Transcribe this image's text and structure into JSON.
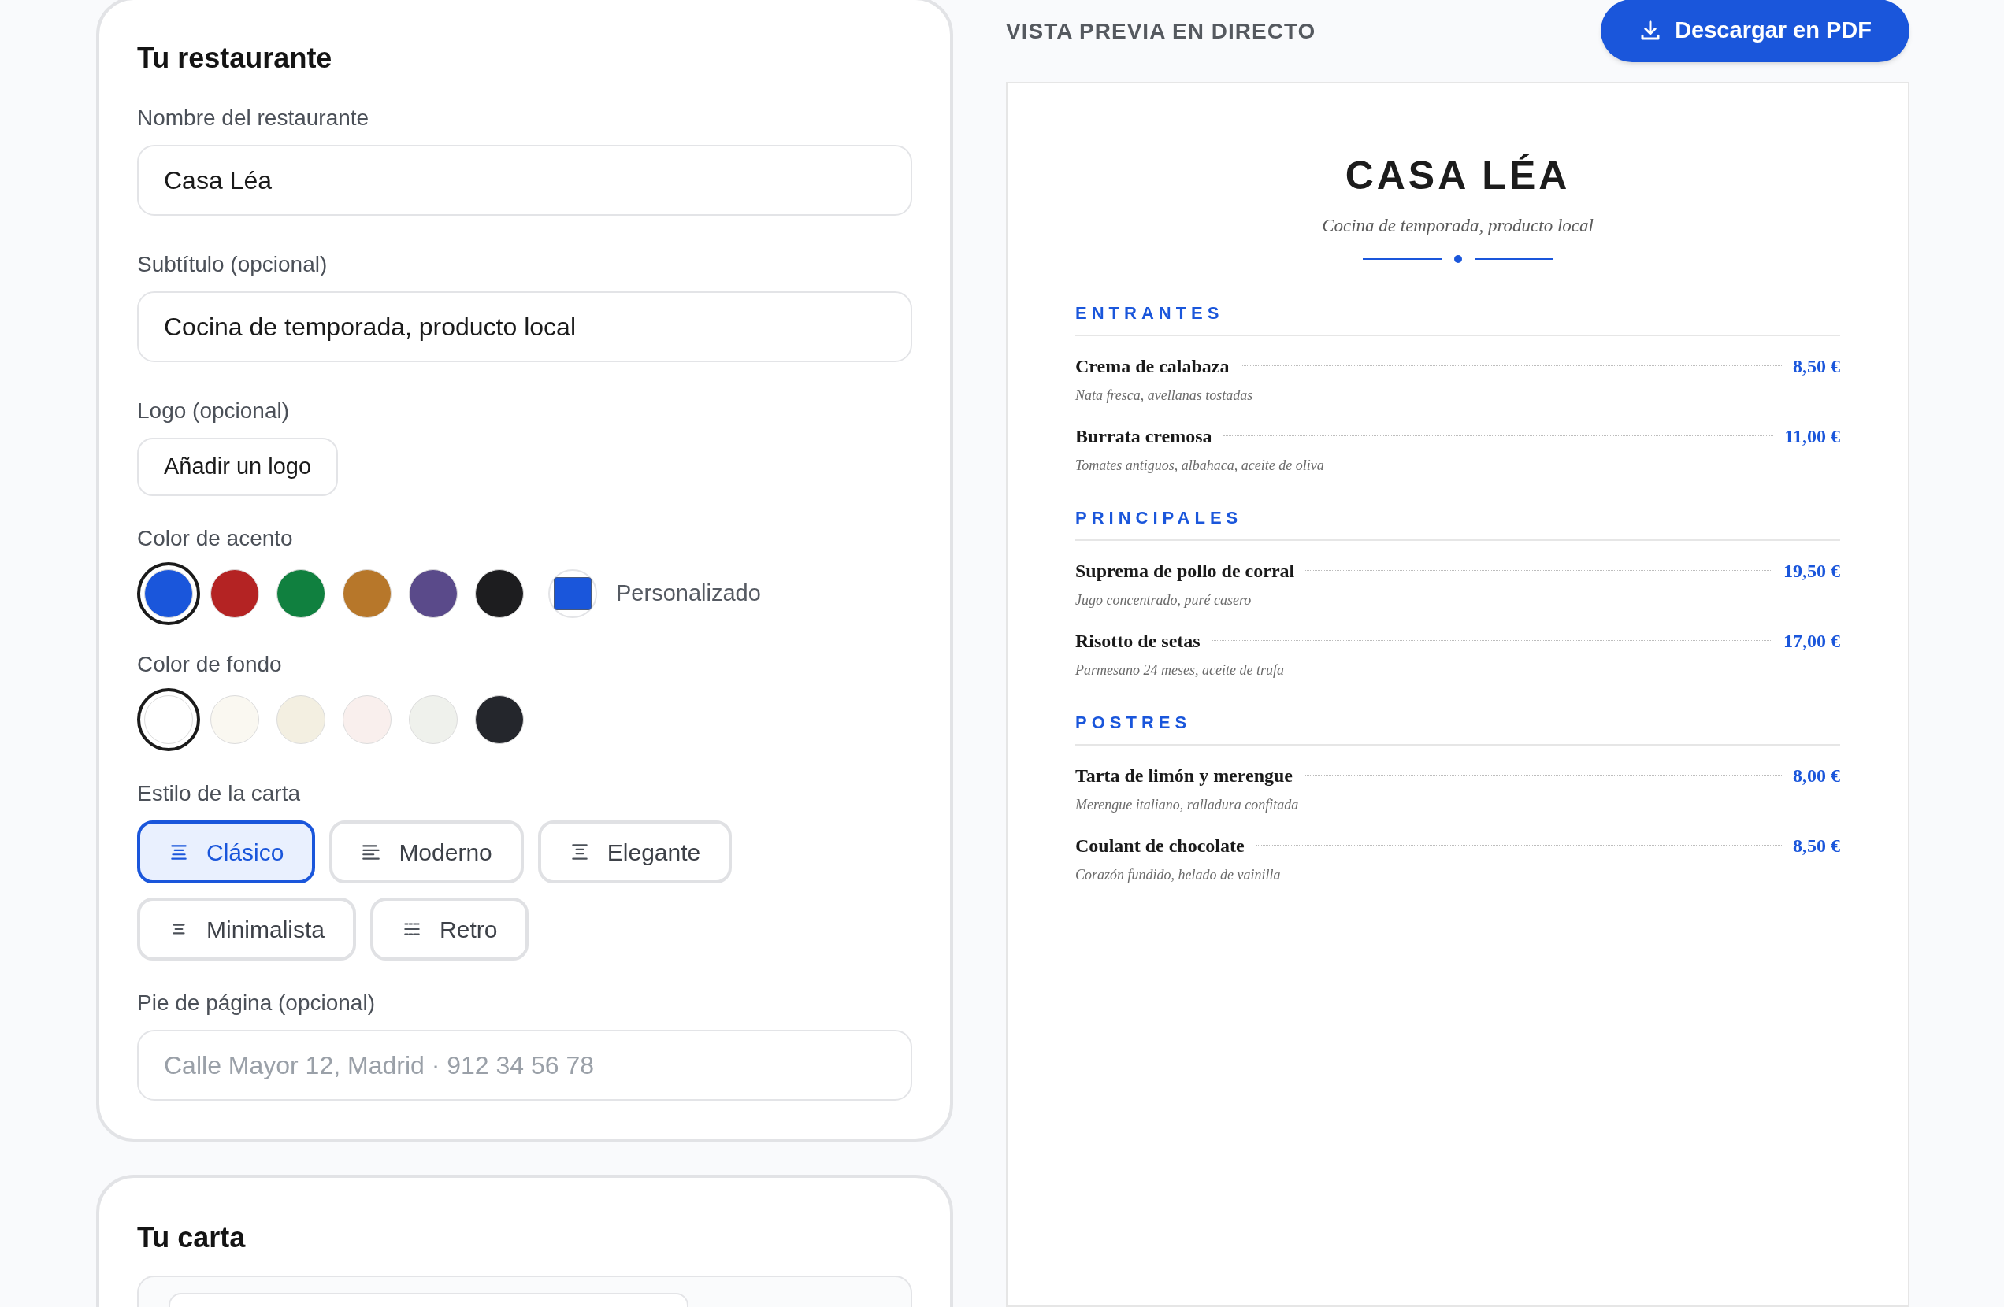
{
  "settings": {
    "title": "Tu restaurante",
    "name_field": {
      "label": "Nombre del restaurante",
      "value": "Casa Léa"
    },
    "subtitle_field": {
      "label": "Subtítulo (opcional)",
      "value": "Cocina de temporada, producto local"
    },
    "logo": {
      "label": "Logo (opcional)",
      "button": "Añadir un logo"
    },
    "accent": {
      "label": "Color de acento",
      "swatches": [
        {
          "color": "#1a56db",
          "selected": true
        },
        {
          "color": "#b42323",
          "selected": false
        },
        {
          "color": "#10803f",
          "selected": false
        },
        {
          "color": "#b7772a",
          "selected": false
        },
        {
          "color": "#5a4a8a",
          "selected": false
        },
        {
          "color": "#1d1d1f",
          "selected": false
        }
      ],
      "custom": {
        "color": "#1a56db",
        "label": "Personalizado"
      }
    },
    "background": {
      "label": "Color de fondo",
      "swatches": [
        {
          "color": "#ffffff",
          "selected": true
        },
        {
          "color": "#faf8f1",
          "selected": false
        },
        {
          "color": "#f3efe1",
          "selected": false
        },
        {
          "color": "#f9efed",
          "selected": false
        },
        {
          "color": "#eff1ec",
          "selected": false
        },
        {
          "color": "#24262c",
          "selected": false
        }
      ]
    },
    "style": {
      "label": "Estilo de la carta",
      "options": [
        {
          "label": "Clásico",
          "kind": "center",
          "selected": true
        },
        {
          "label": "Moderno",
          "kind": "left",
          "selected": false
        },
        {
          "label": "Elegante",
          "kind": "framed",
          "selected": false
        },
        {
          "label": "Minimalista",
          "kind": "short",
          "selected": false
        },
        {
          "label": "Retro",
          "kind": "dashed",
          "selected": false
        }
      ]
    },
    "footer_field": {
      "label": "Pie de página (opcional)",
      "placeholder": "Calle Mayor 12, Madrid · 912 34 56 78"
    }
  },
  "menu_card": {
    "title": "Tu carta"
  },
  "preview": {
    "heading": "VISTA PREVIA EN DIRECTO",
    "download_button": "Descargar en PDF",
    "title": "CASA LÉA",
    "subtitle": "Cocina de temporada, producto local",
    "sections": [
      {
        "title": "ENTRANTES",
        "items": [
          {
            "name": "Crema de calabaza",
            "price": "8,50 €",
            "description": "Nata fresca, avellanas tostadas"
          },
          {
            "name": "Burrata cremosa",
            "price": "11,00 €",
            "description": "Tomates antiguos, albahaca, aceite de oliva"
          }
        ]
      },
      {
        "title": "PRINCIPALES",
        "items": [
          {
            "name": "Suprema de pollo de corral",
            "price": "19,50 €",
            "description": "Jugo concentrado, puré casero"
          },
          {
            "name": "Risotto de setas",
            "price": "17,00 €",
            "description": "Parmesano 24 meses, aceite de trufa"
          }
        ]
      },
      {
        "title": "POSTRES",
        "items": [
          {
            "name": "Tarta de limón y merengue",
            "price": "8,00 €",
            "description": "Merengue italiano, ralladura confitada"
          },
          {
            "name": "Coulant de chocolate",
            "price": "8,50 €",
            "description": "Corazón fundido, helado de vainilla"
          }
        ]
      }
    ]
  }
}
